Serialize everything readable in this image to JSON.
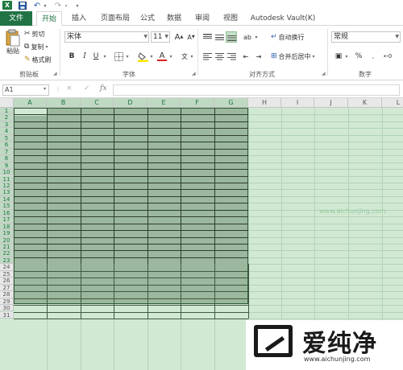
{
  "app": {
    "logo_letter": "X",
    "accent_color": "#217346"
  },
  "quick_access": {
    "save_icon": "save-icon",
    "undo_icon": "undo-icon",
    "redo_icon": "redo-icon"
  },
  "tabs": [
    {
      "label": "文件"
    },
    {
      "label": "开始"
    },
    {
      "label": "插入"
    },
    {
      "label": "页面布局"
    },
    {
      "label": "公式"
    },
    {
      "label": "数据"
    },
    {
      "label": "审阅"
    },
    {
      "label": "视图"
    },
    {
      "label": "Autodesk Vault(K)"
    }
  ],
  "clipboard": {
    "paste_label": "粘贴",
    "cut_label": "剪切",
    "copy_label": "复制",
    "format_painter_label": "格式刷",
    "group_label": "剪贴板"
  },
  "font": {
    "name_value": "宋体",
    "size_value": "11",
    "grow_label": "A",
    "shrink_label": "A",
    "bold": "B",
    "italic": "I",
    "underline": "U",
    "color_letter": "A",
    "group_label": "字体"
  },
  "alignment": {
    "wrap_label": "自动换行",
    "merge_label": "合并后居中",
    "group_label": "对齐方式"
  },
  "number": {
    "format_value": "常规",
    "percent": "%",
    "group_label": "数字"
  },
  "formula_bar": {
    "namebox_value": "A1",
    "cancel": "×",
    "enter": "✓",
    "fx": "fx"
  },
  "columns": [
    "A",
    "B",
    "C",
    "D",
    "E",
    "F",
    "G",
    "H",
    "I",
    "J",
    "K",
    "L"
  ],
  "rows": [
    "1",
    "2",
    "3",
    "4",
    "5",
    "6",
    "7",
    "8",
    "9",
    "10",
    "11",
    "12",
    "13",
    "14",
    "15",
    "16",
    "17",
    "18",
    "19",
    "20",
    "21",
    "22",
    "23",
    "24",
    "25",
    "26",
    "27",
    "28",
    "29",
    "30",
    "31"
  ],
  "selection": {
    "start": "A1",
    "end": "G23",
    "fill_color": "#9bb89e"
  },
  "watermark": {
    "text": "爱纯净",
    "url": "www.aichunjing.com"
  },
  "overlay_url": "www.aichunjing.com"
}
